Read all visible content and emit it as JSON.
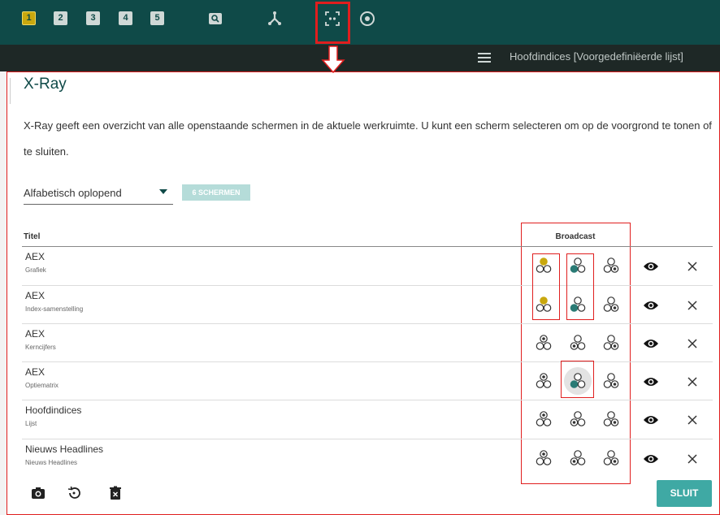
{
  "topbar": {
    "workspaces": [
      "1",
      "2",
      "3",
      "4",
      "5"
    ],
    "active_workspace": "1",
    "icons": [
      "search-icon",
      "network-icon",
      "xray-icon",
      "target-icon"
    ]
  },
  "subbar": {
    "title": "Hoofdindices [Voorgedefiniëerde lijst]"
  },
  "panel": {
    "title": "X-Ray",
    "description": "X-Ray geeft een overzicht van alle openstaande schermen in de aktuele werkruimte. U kunt een scherm selecteren om op de voorgrond te tonen of te sluiten.",
    "sort_value": "Alfabetisch oplopend",
    "count_label": "6 SCHERMEN",
    "col_titel": "Titel",
    "col_broadcast": "Broadcast",
    "rows": [
      {
        "title": "AEX",
        "subtitle": "Grafiek"
      },
      {
        "title": "AEX",
        "subtitle": "Index-samenstelling"
      },
      {
        "title": "AEX",
        "subtitle": "Kerncijfers"
      },
      {
        "title": "AEX",
        "subtitle": "Optiematrix"
      },
      {
        "title": "Hoofdindices",
        "subtitle": "Lijst"
      },
      {
        "title": "Nieuws Headlines",
        "subtitle": "Nieuws Headlines"
      }
    ],
    "close_label": "SLUIT"
  },
  "colors": {
    "header_bg": "#0f4a48",
    "subbar_bg": "#1e2826",
    "accent_teal": "#2a7b75",
    "accent_yellow": "#c9a80e",
    "highlight_red": "#e01e1e",
    "button_teal": "#3fa9a4"
  }
}
